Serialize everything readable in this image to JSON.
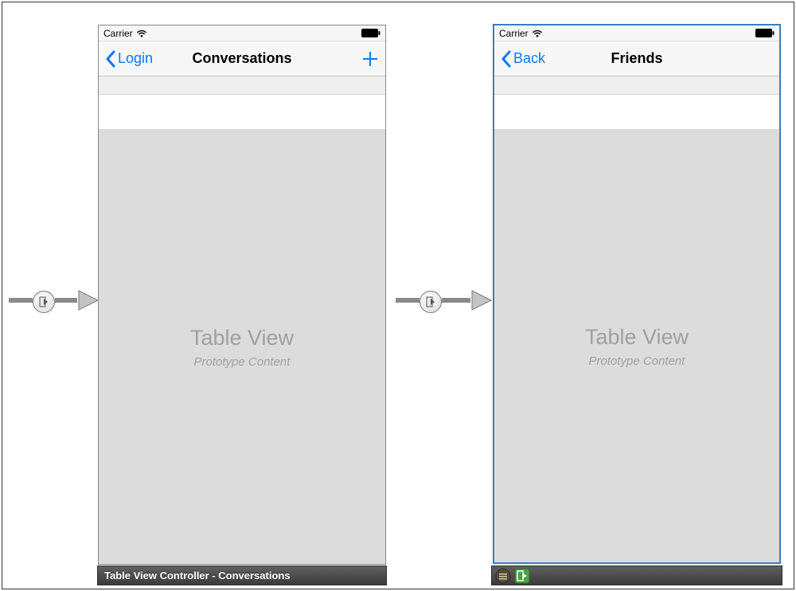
{
  "statusbar": {
    "carrier": "Carrier"
  },
  "screens": {
    "left": {
      "back_label": "Login",
      "title": "Conversations",
      "tableview_title": "Table View",
      "tableview_subtitle": "Prototype Content",
      "below_label": "Table View Controller - Conversations"
    },
    "right": {
      "back_label": "Back",
      "title": "Friends",
      "tableview_title": "Table View",
      "tableview_subtitle": "Prototype Content"
    }
  }
}
